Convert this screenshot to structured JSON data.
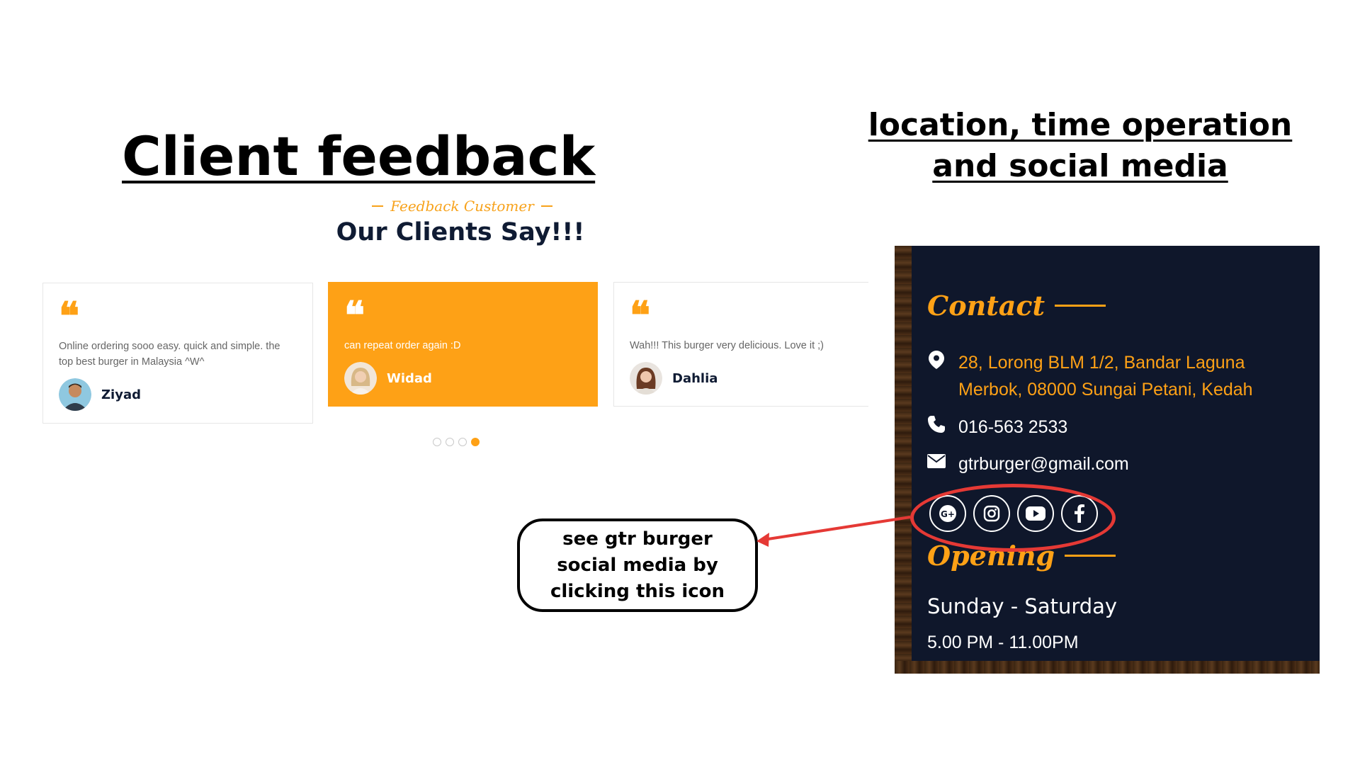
{
  "left_heading": "Client feedback ",
  "right_heading": "location, time operation and social media",
  "feedback": {
    "subtitle": "Feedback Customer",
    "title": "Our Clients Say!!!",
    "testimonials": [
      {
        "text": "Online ordering sooo easy. quick and simple. the top best burger in Malaysia ^W^",
        "name": "Ziyad",
        "active": false
      },
      {
        "text": "can repeat order again :D",
        "name": "Widad",
        "active": true
      },
      {
        "text": "Wah!!! This burger very delicious. Love it ;)",
        "name": "Dahlia",
        "active": false
      }
    ],
    "pagination": {
      "total": 4,
      "active_index": 3
    }
  },
  "contact": {
    "title": "Contact",
    "address": "28, Lorong BLM 1/2, Bandar Laguna Merbok, 08000 Sungai Petani, Kedah",
    "phone": "016-563 2533",
    "email": "gtrburger@gmail.com",
    "social_icons": [
      "google-plus-icon",
      "instagram-icon",
      "youtube-icon",
      "facebook-icon"
    ]
  },
  "opening": {
    "title": "Opening",
    "days": "Sunday - Saturday",
    "time": "5.00 PM - 11.00PM"
  },
  "annotation": {
    "callout_text": "see gtr burger social media by clicking this icon",
    "color": "#e53935"
  },
  "colors": {
    "accent": "#fea116",
    "dark": "#0f172b",
    "title": "#0f1b33"
  }
}
